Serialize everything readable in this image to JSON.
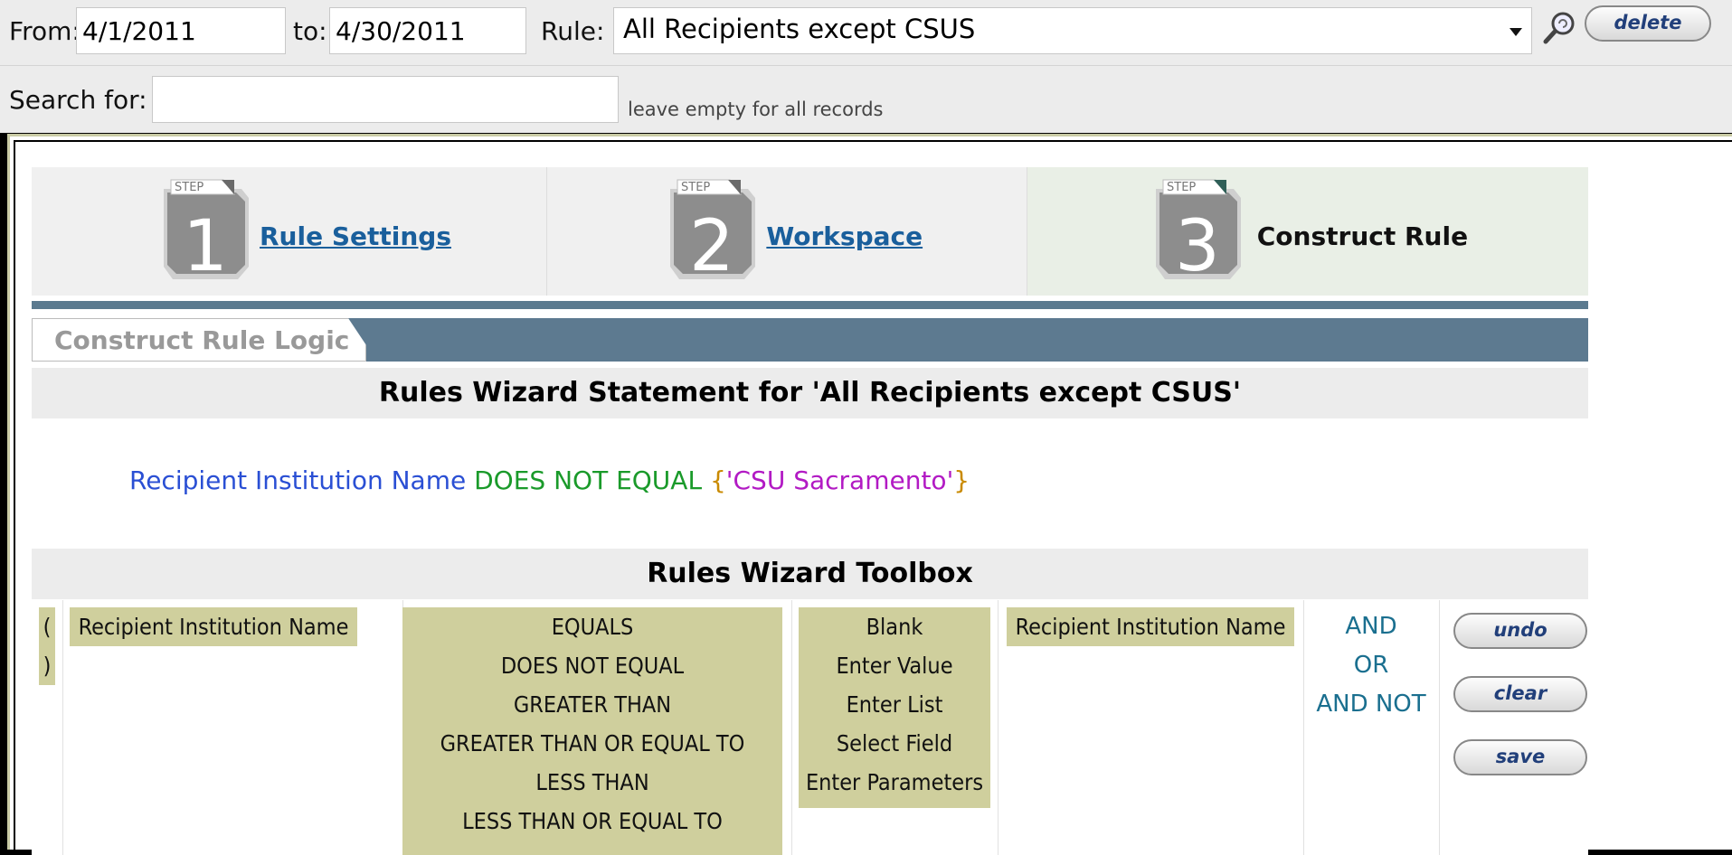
{
  "filters": {
    "from_label": "From:",
    "from_value": "4/1/2011",
    "to_label": "to:",
    "to_value": "4/30/2011",
    "rule_label": "Rule:",
    "rule_value": "All Recipients except CSUS",
    "delete_label": "delete",
    "search_label": "Search for:",
    "search_value": "",
    "search_hint": "leave empty for all records"
  },
  "steps": [
    {
      "step_word": "STEP",
      "number": "1",
      "label": "Rule Settings",
      "state": "link"
    },
    {
      "step_word": "STEP",
      "number": "2",
      "label": "Workspace",
      "state": "link"
    },
    {
      "step_word": "STEP",
      "number": "3",
      "label": "Construct Rule",
      "state": "current"
    }
  ],
  "tab": {
    "label": "Construct Rule Logic"
  },
  "statement": {
    "heading": "Rules Wizard Statement for 'All Recipients except CSUS'",
    "field": "Recipient Institution Name",
    "operator": "DOES NOT EQUAL",
    "open_brace": "{",
    "value": "'CSU Sacramento'",
    "close_brace": "}"
  },
  "toolbox": {
    "heading": "Rules Wizard Toolbox",
    "paren_open": "(",
    "paren_close": ")",
    "field_left": "Recipient Institution Name",
    "operators": [
      "EQUALS",
      "DOES NOT EQUAL",
      "GREATER THAN",
      "GREATER THAN OR EQUAL TO",
      "LESS THAN",
      "LESS THAN OR EQUAL TO"
    ],
    "value_types": [
      "Blank",
      "Enter Value",
      "Enter List",
      "Select Field",
      "Enter Parameters"
    ],
    "field_right": "Recipient Institution Name",
    "logic": [
      "AND",
      "OR",
      "AND NOT"
    ],
    "buttons": {
      "undo": "undo",
      "clear": "clear",
      "save": "save"
    }
  },
  "colors": {
    "accent_bar": "#5d7a90",
    "chip": "#cfcf9d",
    "link": "#1a5f9c",
    "field_text": "#2a4fd4",
    "operator_text": "#1a9a2a",
    "value_text": "#b21ac4"
  }
}
